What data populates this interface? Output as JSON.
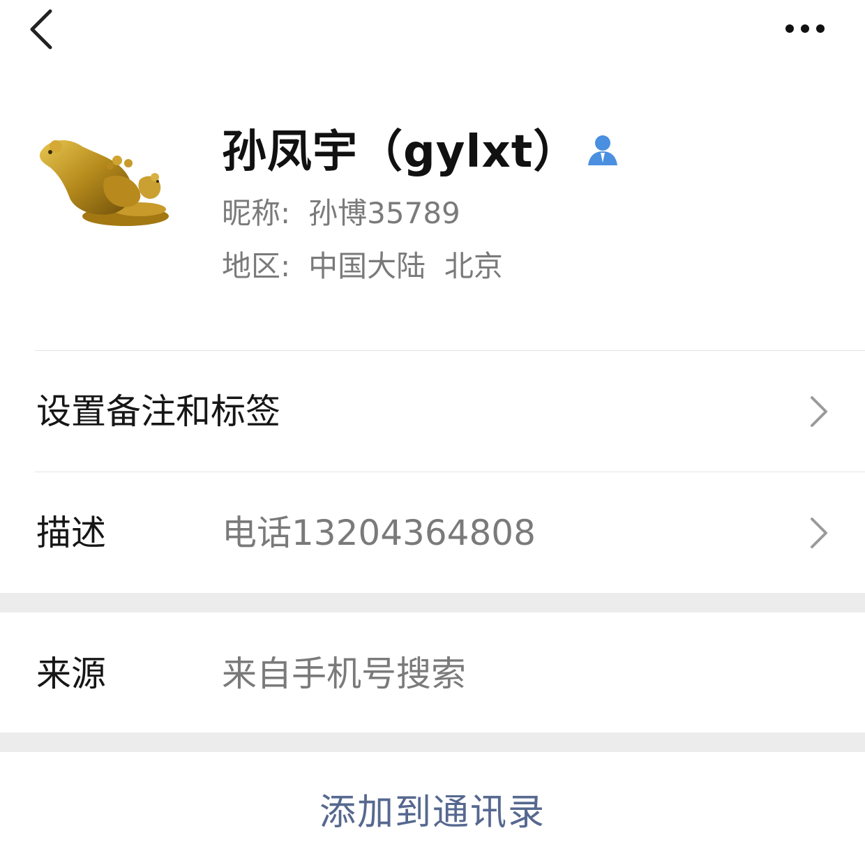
{
  "topbar": {
    "back_icon": "chevron-left-icon",
    "more_icon": "more-horizontal-icon"
  },
  "profile": {
    "avatar_icon": "golden-rat-statue-image",
    "name": "孙凤宇（gylxt）",
    "contact_icon": "contact-person-icon",
    "contact_icon_color": "#4a8fe0",
    "nickname_label": "昵称:",
    "nickname_value": "孙博35789",
    "region_label": "地区:",
    "region_value": "中国大陆  北京"
  },
  "rows": {
    "remark": {
      "label": "设置备注和标签"
    },
    "description": {
      "label": "描述",
      "value": "电话13204364808"
    },
    "source": {
      "label": "来源",
      "value": "来自手机号搜索"
    }
  },
  "actions": {
    "add_contact_label": "添加到通讯录",
    "add_contact_color": "#56688f"
  }
}
